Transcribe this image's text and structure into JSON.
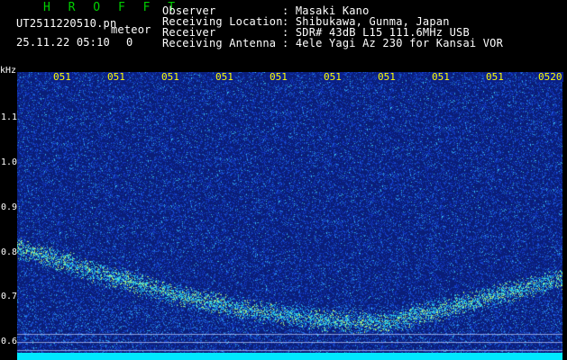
{
  "header": {
    "brand": "H R O F F T",
    "filename": "UT2511220510.pn",
    "type_label": "meteor",
    "datetime": "25.11.22 05:10",
    "counter": "0",
    "info": [
      {
        "label": "Observer",
        "value": ": Masaki Kano"
      },
      {
        "label": "Receiving Location",
        "value": ": Shibukawa, Gunma, Japan"
      },
      {
        "label": "Receiver",
        "value": ": SDR# 43dB L15 111.6MHz USB"
      },
      {
        "label": "Receiving Antenna",
        "value": ": 4ele Yagi Az 230 for Kansai VOR"
      }
    ]
  },
  "axis": {
    "unit": "kHz",
    "y_ticks": [
      "1.1",
      "1.0",
      "0.9",
      "0.8",
      "0.7",
      "0.6"
    ],
    "x_ticks": [
      "051",
      "051",
      "051",
      "051",
      "051",
      "051",
      "051",
      "051",
      "051",
      "0520"
    ]
  },
  "colors": {
    "background": "#0a1f8a",
    "signal": "#00e8ff",
    "text": "#ffffff",
    "accent": "#ffff00",
    "brand": "#00d000"
  }
}
